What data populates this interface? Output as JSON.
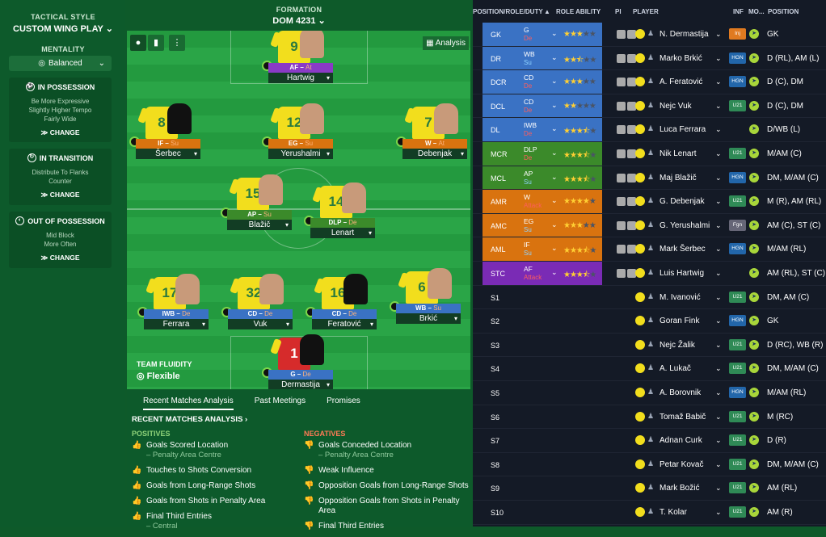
{
  "sidebar": {
    "tactical_style_label": "TACTICAL STYLE",
    "tactical_style": "CUSTOM WING PLAY",
    "mentality_label": "MENTALITY",
    "mentality": "Balanced",
    "in_possession": {
      "title": "IN POSSESSION",
      "desc1": "Be More Expressive",
      "desc2": "Slightly Higher Tempo",
      "desc3": "Fairly Wide",
      "change": "CHANGE"
    },
    "in_transition": {
      "title": "IN TRANSITION",
      "desc1": "Distribute To Flanks",
      "desc2": "Counter",
      "change": "CHANGE"
    },
    "out_of_possession": {
      "title": "OUT OF POSSESSION",
      "desc1": "Mid Block",
      "desc2": "More Often",
      "change": "CHANGE"
    }
  },
  "formation": {
    "label": "FORMATION",
    "value": "DOM 4231"
  },
  "pitch": {
    "analysis_label": "Analysis",
    "fluidity_label": "TEAM FLUIDITY",
    "fluidity": "Flexible",
    "players": [
      {
        "num": "9",
        "role": "AF",
        "duty": "At",
        "name": "Hartwig"
      },
      {
        "num": "8",
        "role": "IF",
        "duty": "Su",
        "name": "Šerbec"
      },
      {
        "num": "12",
        "role": "EG",
        "duty": "Su",
        "name": "Yerushalmi"
      },
      {
        "num": "7",
        "role": "W",
        "duty": "At",
        "name": "Debenjak"
      },
      {
        "num": "15",
        "role": "AP",
        "duty": "Su",
        "name": "Blažič"
      },
      {
        "num": "14",
        "role": "DLP",
        "duty": "De",
        "name": "Lenart"
      },
      {
        "num": "17",
        "role": "IWB",
        "duty": "De",
        "name": "Ferrara"
      },
      {
        "num": "32",
        "role": "CD",
        "duty": "De",
        "name": "Vuk"
      },
      {
        "num": "16",
        "role": "CD",
        "duty": "De",
        "name": "Feratović"
      },
      {
        "num": "6",
        "role": "WB",
        "duty": "Su",
        "name": "Brkić"
      },
      {
        "num": "1",
        "role": "G",
        "duty": "De",
        "name": "Dermastija"
      }
    ]
  },
  "analysis": {
    "tabs": [
      "Recent Matches Analysis",
      "Past Meetings",
      "Promises"
    ],
    "section_title": "RECENT MATCHES ANALYSIS ›",
    "positives_label": "POSITIVES",
    "negatives_label": "NEGATIVES",
    "positives": [
      {
        "text": "Goals Scored Location",
        "sub": "– Penalty Area Centre"
      },
      {
        "text": "Touches to Shots Conversion",
        "sub": ""
      },
      {
        "text": "Goals from Long-Range Shots",
        "sub": ""
      },
      {
        "text": "Goals from Shots in Penalty Area",
        "sub": ""
      },
      {
        "text": "Final Third Entries",
        "sub": "– Central"
      }
    ],
    "negatives": [
      {
        "text": "Goals Conceded Location",
        "sub": "– Penalty Area Centre"
      },
      {
        "text": "Weak Influence",
        "sub": ""
      },
      {
        "text": "Opposition Goals from Long-Range Shots",
        "sub": ""
      },
      {
        "text": "Opposition Goals from Shots in Penalty Area",
        "sub": ""
      },
      {
        "text": "Final Third Entries",
        "sub": ""
      }
    ]
  },
  "table": {
    "headers": {
      "pos": "POSITION/ROLE/DUTY",
      "ability": "ROLE ABILITY",
      "pi": "PI",
      "player": "PLAYER",
      "inf": "INF",
      "mo": "MO...",
      "position": "POSITION"
    },
    "rows": [
      {
        "pos": "GK",
        "role": "G",
        "duty": "De",
        "stars": 3,
        "name": "N. Dermastija",
        "inf": "Inj",
        "position": "GK",
        "color": "#3a72c4"
      },
      {
        "pos": "DR",
        "role": "WB",
        "duty": "Su",
        "stars": 2.5,
        "name": "Marko Brkić",
        "inf": "HGN",
        "position": "D (RL), AM (L)",
        "color": "#3a72c4"
      },
      {
        "pos": "DCR",
        "role": "CD",
        "duty": "De",
        "stars": 3,
        "name": "A. Feratović",
        "inf": "HGN",
        "position": "D (C), DM",
        "color": "#3a72c4"
      },
      {
        "pos": "DCL",
        "role": "CD",
        "duty": "De",
        "stars": 2,
        "name": "Nejc Vuk",
        "inf": "U21",
        "position": "D (C), DM",
        "color": "#3a72c4"
      },
      {
        "pos": "DL",
        "role": "IWB",
        "duty": "De",
        "stars": 3.5,
        "name": "Luca Ferrara",
        "inf": "",
        "position": "D/WB (L)",
        "color": "#3a72c4"
      },
      {
        "pos": "MCR",
        "role": "DLP",
        "duty": "De",
        "stars": 3.5,
        "name": "Nik Lenart",
        "inf": "U21",
        "position": "M/AM (C)",
        "color": "#3b8a2a"
      },
      {
        "pos": "MCL",
        "role": "AP",
        "duty": "Su",
        "stars": 3.5,
        "name": "Maj Blažič",
        "inf": "HGN",
        "position": "DM, M/AM (C)",
        "color": "#3b8a2a"
      },
      {
        "pos": "AMR",
        "role": "W",
        "duty": "Attack",
        "stars": 4,
        "name": "G. Debenjak",
        "inf": "U21",
        "position": "M (R), AM (RL)",
        "color": "#d9730f"
      },
      {
        "pos": "AMC",
        "role": "EG",
        "duty": "Su",
        "stars": 3,
        "name": "G. Yerushalmi",
        "inf": "Fgn",
        "position": "AM (C), ST (C)",
        "color": "#d9730f"
      },
      {
        "pos": "AML",
        "role": "IF",
        "duty": "Su",
        "stars": 3.5,
        "name": "Mark Šerbec",
        "inf": "HGN",
        "position": "M/AM (RL)",
        "color": "#d9730f"
      },
      {
        "pos": "STC",
        "role": "AF",
        "duty": "Attack",
        "stars": 3.5,
        "name": "Luis Hartwig",
        "inf": "",
        "position": "AM (RL), ST (C)",
        "color": "#7a2bb5"
      },
      {
        "pos": "S1",
        "role": "",
        "duty": "",
        "stars": 0,
        "name": "M. Ivanović",
        "inf": "U21",
        "position": "DM, AM (C)",
        "color": ""
      },
      {
        "pos": "S2",
        "role": "",
        "duty": "",
        "stars": 0,
        "name": "Goran Fink",
        "inf": "HGN",
        "position": "GK",
        "color": ""
      },
      {
        "pos": "S3",
        "role": "",
        "duty": "",
        "stars": 0,
        "name": "Nejc Žalik",
        "inf": "U21",
        "position": "D (RC), WB (R)",
        "color": ""
      },
      {
        "pos": "S4",
        "role": "",
        "duty": "",
        "stars": 0,
        "name": "A. Lukač",
        "inf": "U21",
        "position": "DM, M/AM (C)",
        "color": ""
      },
      {
        "pos": "S5",
        "role": "",
        "duty": "",
        "stars": 0,
        "name": "A. Borovnik",
        "inf": "HGN",
        "position": "M/AM (RL)",
        "color": ""
      },
      {
        "pos": "S6",
        "role": "",
        "duty": "",
        "stars": 0,
        "name": "Tomaž Babič",
        "inf": "U21",
        "position": "M (RC)",
        "color": ""
      },
      {
        "pos": "S7",
        "role": "",
        "duty": "",
        "stars": 0,
        "name": "Adnan Curk",
        "inf": "U21",
        "position": "D (R)",
        "color": ""
      },
      {
        "pos": "S8",
        "role": "",
        "duty": "",
        "stars": 0,
        "name": "Petar Kovač",
        "inf": "U21",
        "position": "DM, M/AM (C)",
        "color": ""
      },
      {
        "pos": "S9",
        "role": "",
        "duty": "",
        "stars": 0,
        "name": "Mark Božić",
        "inf": "U21",
        "position": "AM (RL)",
        "color": ""
      },
      {
        "pos": "S10",
        "role": "",
        "duty": "",
        "stars": 0,
        "name": "T. Kolar",
        "inf": "U21",
        "position": "AM (R)",
        "color": ""
      }
    ]
  }
}
